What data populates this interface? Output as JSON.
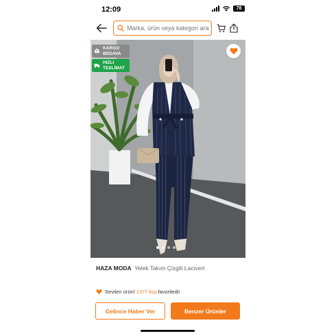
{
  "status_bar": {
    "time": "12:09",
    "battery": "78"
  },
  "search": {
    "placeholder": "Marka, ürün veya kategori ara"
  },
  "badges": {
    "cargo": {
      "line1": "KARGO",
      "line2": "BEDAVA"
    },
    "fast": {
      "line1": "HIZLI",
      "line2": "TESLİMAT"
    }
  },
  "product": {
    "brand": "HAZA MODA",
    "name": "Yelek Takım Çizgili Lacivert"
  },
  "favorites": {
    "prefix": "Sevilen ürün!",
    "count": "1377 kişi",
    "suffix": "favoriledi!"
  },
  "buttons": {
    "notify": "Gelince Haber Ver",
    "similar": "Benzer Ürünler"
  },
  "carousel": {
    "total": 4,
    "active": 1
  },
  "colors": {
    "accent": "#f27a1a",
    "fast_badge": "#1fa44a",
    "cargo_badge": "#8a8a8a"
  },
  "icons": [
    "back-arrow-icon",
    "search-icon",
    "cart-icon",
    "share-icon",
    "heart-icon",
    "box-icon",
    "truck-icon"
  ]
}
